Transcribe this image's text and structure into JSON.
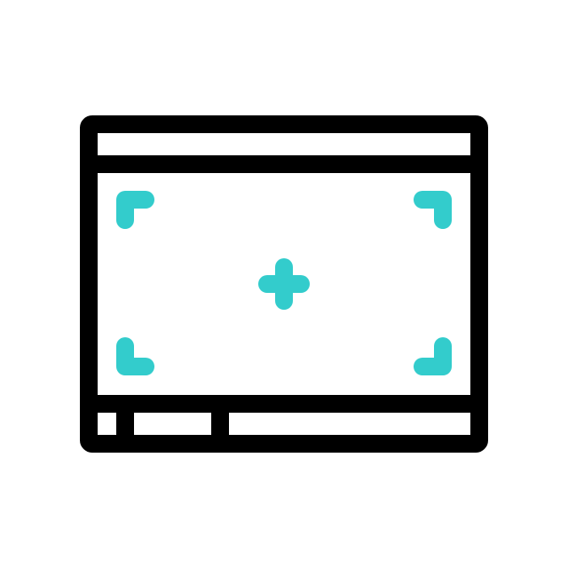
{
  "icon": {
    "name": "viewfinder-window-icon",
    "style": "line-icon",
    "colors": {
      "outline": "#000000",
      "accent": "#33cccc",
      "background": "#ffffff"
    },
    "parts": {
      "window": "window-frame-icon",
      "crosshair": "crosshair-plus-icon",
      "corners": "focus-corner-brackets-icon",
      "status_bar": "status-bar-segments-icon"
    }
  }
}
